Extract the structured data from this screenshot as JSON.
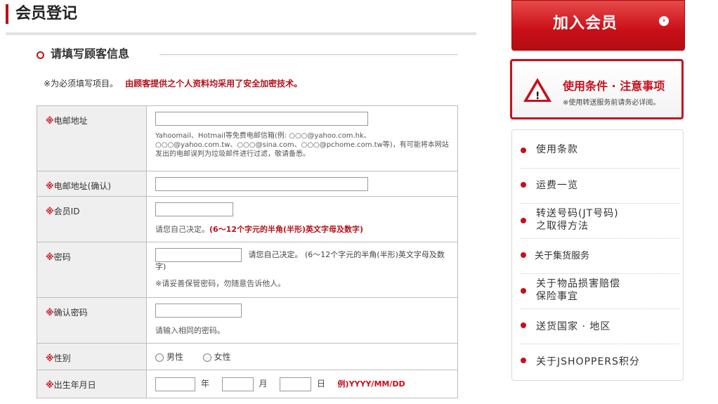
{
  "page": {
    "title": "会员登记"
  },
  "section": {
    "title": "请填写顾客信息"
  },
  "note": {
    "required": "※为必须填写项目。",
    "security": "由顾客提供之个人资料均采用了安全加密技术。"
  },
  "form": {
    "email": {
      "star": "※",
      "label": "电邮地址",
      "hint": "Yahoomail、Hotmail等免费电邮信箱(例: ○○○@yahoo.com.hk、○○○@yahoo.com.tw、○○○@sina.com、○○○@pchome.com.tw等)，有可能将本网站发出的电邮误判为垃圾邮件进行过滤，敬请备悉。"
    },
    "email_confirm": {
      "star": "※",
      "label": "电邮地址(确认)"
    },
    "member_id": {
      "star": "※",
      "label": "会员ID",
      "hint": "请您自己决定。",
      "hint_red": "(6～12个字元的半角(半形)英文字母及数字)"
    },
    "password": {
      "star": "※",
      "label": "密码",
      "hint": "请您自己决定。  (6～12个字元的半角(半形)英文字母及数字)",
      "hint2": "※请妥善保管密码，勿随意告诉他人。"
    },
    "password_confirm": {
      "star": "※",
      "label": "确认密码",
      "hint": "请输入相同的密码。"
    },
    "gender": {
      "star": "※",
      "label": "性别",
      "male": "男性",
      "female": "女性"
    },
    "birthday": {
      "star": "※",
      "label": "出生年月日",
      "year": "年",
      "month": "月",
      "day": "日",
      "example": "例)YYYY/MM/DD"
    }
  },
  "sidebar": {
    "join": "加入会员",
    "terms_title": "使用条件 · 注意事项",
    "terms_sub": "※使用转送服务前请务必详阅。",
    "menu": [
      {
        "line1": "使用条款",
        "line2": ""
      },
      {
        "line1": "运费一览",
        "line2": ""
      },
      {
        "line1": "转送号码(JT号码)",
        "line2": "之取得方法"
      },
      {
        "line1": "关于集货服务",
        "line2": ""
      },
      {
        "line1": "关于物品损害赔偿",
        "line2": "保险事宜"
      },
      {
        "line1": "送货国家 · 地区",
        "line2": ""
      },
      {
        "line1": "关于JSHOPPERS积分",
        "line2": ""
      }
    ]
  },
  "colors": {
    "accent": "#c7101b"
  }
}
